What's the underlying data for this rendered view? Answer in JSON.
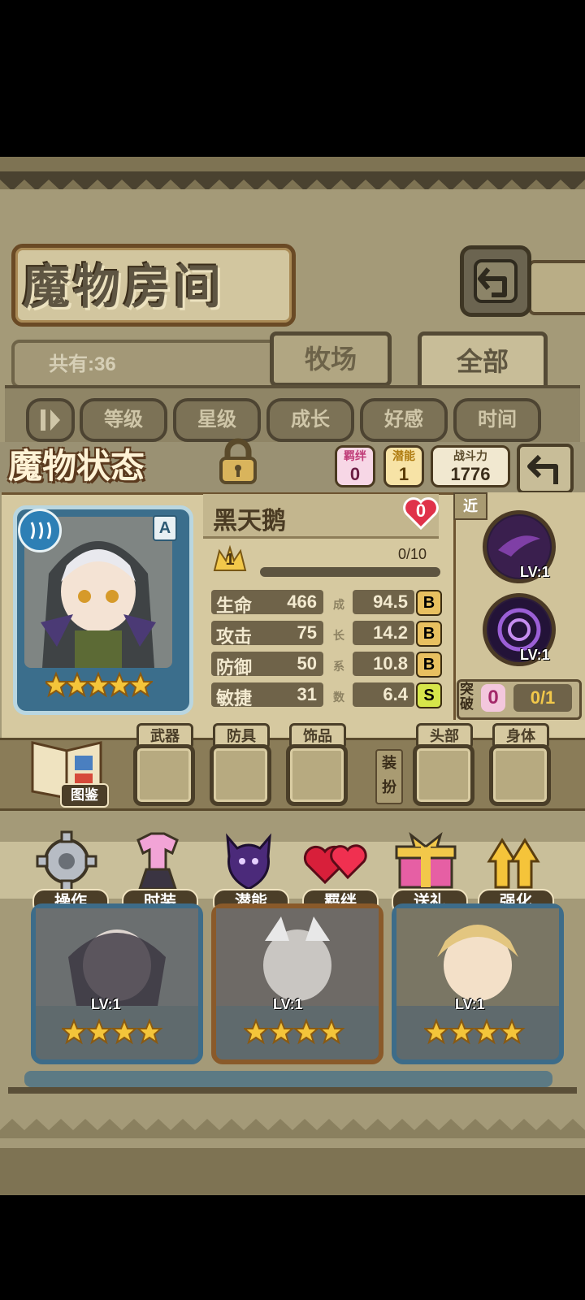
{
  "header": {
    "title": "魔物房间",
    "count_label": "共有:36"
  },
  "tabs": [
    {
      "label": "牧场"
    },
    {
      "label": "全部"
    }
  ],
  "filters": [
    {
      "label": "等级"
    },
    {
      "label": "星级"
    },
    {
      "label": "成长"
    },
    {
      "label": "好感"
    },
    {
      "label": "时间"
    }
  ],
  "status": {
    "banner": "魔物状态",
    "bond_label": "羁绊",
    "bond_value": "0",
    "potential_label": "潜能",
    "potential_value": "1",
    "power_label": "战斗力",
    "power_value": "1776"
  },
  "monster": {
    "name": "黑天鹅",
    "rank_badge": "A",
    "heart_value": "0",
    "level": "1",
    "exp": "0/10",
    "stars": 5,
    "stats": [
      {
        "label": "生命",
        "value": "466",
        "growth": "94.5",
        "grade": "B"
      },
      {
        "label": "攻击",
        "value": "75",
        "growth": "14.2",
        "grade": "B"
      },
      {
        "label": "防御",
        "value": "50",
        "growth": "10.8",
        "grade": "B"
      },
      {
        "label": "敏捷",
        "value": "31",
        "growth": "6.4",
        "grade": "S"
      }
    ],
    "growth_vertical": [
      "成",
      "长",
      "系",
      "数"
    ]
  },
  "skills": {
    "range_label": "近",
    "items": [
      {
        "level": "LV:1"
      },
      {
        "level": "LV:1"
      }
    ],
    "break_label": "突破",
    "break_value": "0",
    "break_progress": "0/1"
  },
  "equipment": {
    "encyclopedia_label": "图鉴",
    "outfit_label": "装扮",
    "slots": [
      {
        "label": "武器"
      },
      {
        "label": "防具"
      },
      {
        "label": "饰品"
      },
      {
        "label": "头部"
      },
      {
        "label": "身体"
      }
    ]
  },
  "actions": [
    {
      "label": "操作",
      "icon": "gear-icon"
    },
    {
      "label": "时装",
      "icon": "outfit-icon"
    },
    {
      "label": "潜能",
      "icon": "demon-icon"
    },
    {
      "label": "羁绊",
      "icon": "hearts-icon"
    },
    {
      "label": "送礼",
      "icon": "gift-icon"
    },
    {
      "label": "强化",
      "icon": "arrow-up-icon"
    }
  ],
  "monster_cards": [
    {
      "level": "LV:1",
      "stars": 4
    },
    {
      "level": "LV:1",
      "stars": 4
    },
    {
      "level": "LV:1",
      "stars": 4
    }
  ],
  "colors": {
    "grade_b": "#e8c060",
    "grade_s": "#d6e64a",
    "frame_blue": "#3d6c89"
  }
}
